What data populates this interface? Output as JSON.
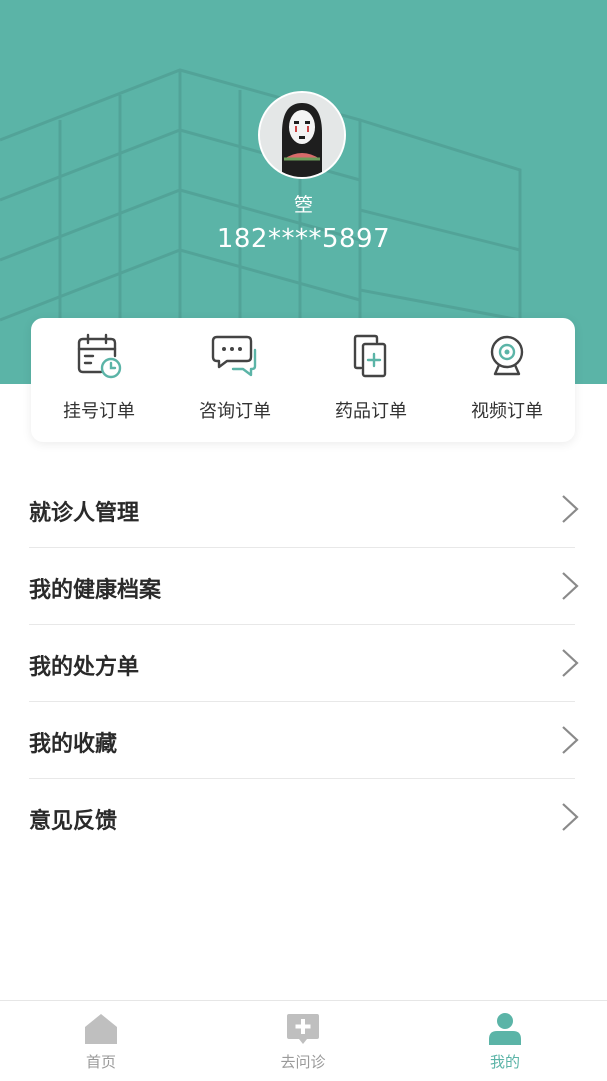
{
  "profile": {
    "username": "箜",
    "phone": "182****5897"
  },
  "orders": [
    {
      "label": "挂号订单",
      "icon": "calendar-clock-icon"
    },
    {
      "label": "咨询订单",
      "icon": "chat-bubbles-icon"
    },
    {
      "label": "药品订单",
      "icon": "medicine-copy-icon"
    },
    {
      "label": "视频订单",
      "icon": "webcam-icon"
    }
  ],
  "menu": [
    {
      "label": "就诊人管理"
    },
    {
      "label": "我的健康档案"
    },
    {
      "label": "我的处方单"
    },
    {
      "label": "我的收藏"
    },
    {
      "label": "意见反馈"
    }
  ],
  "tabs": [
    {
      "label": "首页",
      "icon": "home-icon",
      "active": false
    },
    {
      "label": "去问诊",
      "icon": "consult-icon",
      "active": false
    },
    {
      "label": "我的",
      "icon": "profile-icon",
      "active": true
    }
  ],
  "colors": {
    "accent": "#5bb4a7",
    "tab_inactive": "#9a9a9a",
    "text_dark": "#2a2a2a"
  }
}
